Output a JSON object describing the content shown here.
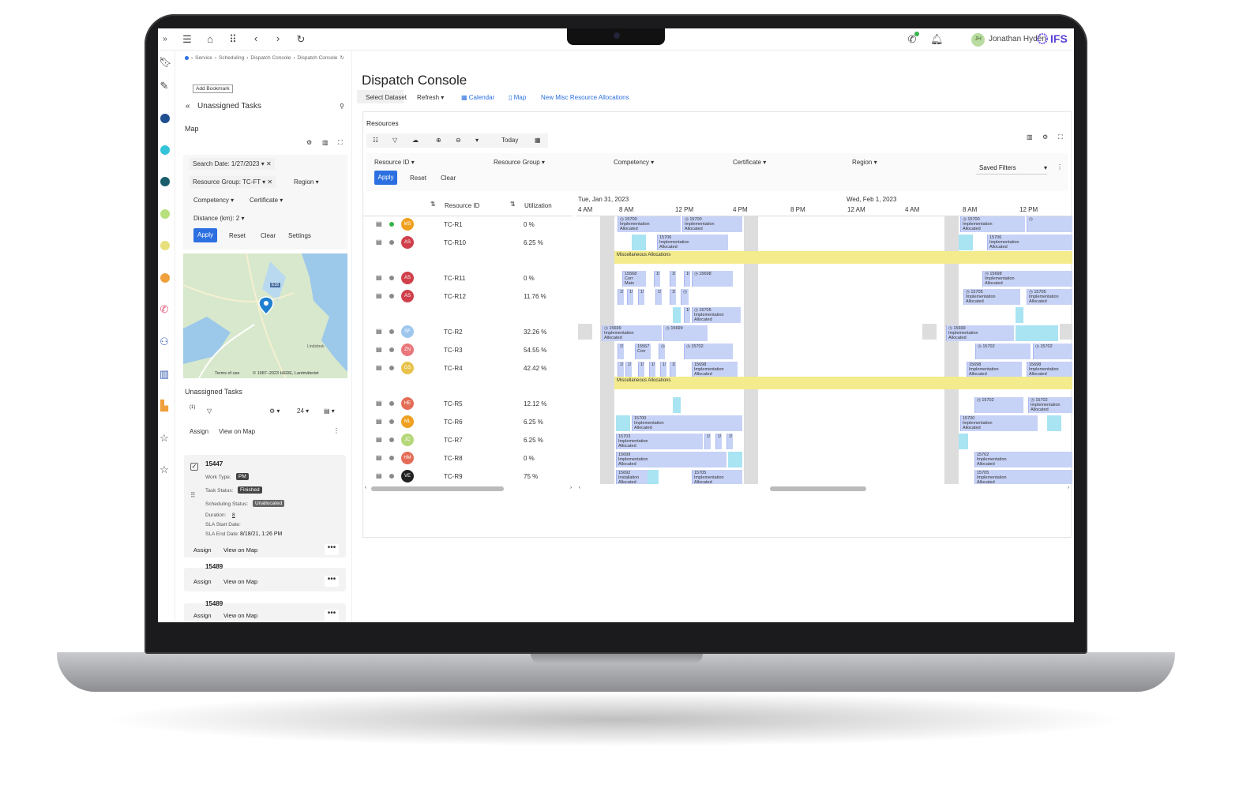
{
  "app": {
    "logo": "IFS",
    "user_initials": "JH",
    "user_name": "Jonathan Hydén"
  },
  "breadcrumb": [
    "Service",
    "Scheduling",
    "Dispatch Console",
    "Dispatch Console"
  ],
  "tooltip": "Add Bookmark",
  "left_panel": {
    "title": "Unassigned Tasks",
    "map_title": "Map",
    "filters": {
      "search_date": "Search Date: 1/27/2023",
      "resource_group": "Resource Group: TC-FT",
      "region": "Region",
      "competency": "Competency",
      "certificate": "Certificate",
      "distance": "Distance (km): 2"
    },
    "buttons": {
      "apply": "Apply",
      "reset": "Reset",
      "clear": "Clear",
      "settings": "Settings"
    },
    "map_footer": {
      "terms": "Terms of use",
      "copyright": "© 1987–2023 HERE, Lantmäteriet",
      "road": "E18",
      "place": "Lindsbruk"
    },
    "tasks_title": "Unassigned Tasks",
    "tasks_count": "(1)",
    "page_size": "24",
    "assign": "Assign",
    "view_on_map": "View on Map",
    "task": {
      "id": "15447",
      "work_type_label": "Work Type:",
      "work_type": "PM",
      "task_status_label": "Task Status:",
      "task_status": "Finished",
      "scheduling_status_label": "Scheduling Status:",
      "scheduling_status": "Unallocated",
      "duration_label": "Duration:",
      "duration": "8",
      "sla_start_label": "SLA Start Date:",
      "sla_end_label": "SLA End Date:",
      "sla_end": "8/18/21, 1:26 PM"
    },
    "more_tasks": [
      "15489",
      "15489",
      "15489"
    ]
  },
  "main": {
    "title": "Dispatch Console",
    "toolbar": {
      "select_dataset": "Select Dataset",
      "refresh": "Refresh",
      "calendar": "Calendar",
      "map": "Map",
      "new_misc": "New Misc Resource Allocations"
    },
    "resources_title": "Resources",
    "today": "Today",
    "filters": [
      "Resource ID",
      "Resource Group",
      "Competency",
      "Certificate",
      "Region"
    ],
    "apply": "Apply",
    "reset": "Reset",
    "clear": "Clear",
    "saved_filters": "Saved Filters",
    "columns": {
      "resource_id": "Resource ID",
      "utilization": "Utilization"
    },
    "dates": {
      "day1": "Tue, Jan 31, 2023",
      "day2": "Wed, Feb 1, 2023"
    },
    "hours": [
      "4 AM",
      "8 AM",
      "12 PM",
      "4 PM",
      "8 PM",
      "12 AM",
      "4 AM",
      "8 AM",
      "12 PM"
    ],
    "misc": "Miscellaneous Allocations",
    "bar_text": {
      "impl": "Implementation",
      "alloc": "Allocated",
      "install": "Installation",
      "corr": "Corr",
      "main": "Main",
      "p": "Pr",
      "m": "M",
      "one": "1!"
    },
    "ids": [
      "15700",
      "15706",
      "15568",
      "15698",
      "15705",
      "15699",
      "15567",
      "15702",
      "15703",
      "15692"
    ],
    "resources": [
      {
        "initials": "MS",
        "color": "#f0a020",
        "status": "#36b24a",
        "id": "TC-R1",
        "util": "0 %"
      },
      {
        "initials": "AS",
        "color": "#d0404a",
        "status": "#8a8a8a",
        "id": "TC-R10",
        "util": "6.25 %"
      },
      {
        "initials": "AS",
        "color": "#d0404a",
        "status": "#8a8a8a",
        "id": "TC-R11",
        "util": "0 %"
      },
      {
        "initials": "AS",
        "color": "#d0404a",
        "status": "#8a8a8a",
        "id": "TC-R12",
        "util": "11.76 %"
      },
      {
        "initials": "SF",
        "color": "#9ec7ee",
        "status": "#8a8a8a",
        "id": "TC-R2",
        "util": "32.26 %"
      },
      {
        "initials": "ZN",
        "color": "#e9767a",
        "status": "#8a8a8a",
        "id": "TC-R3",
        "util": "54.55 %"
      },
      {
        "initials": "GS",
        "color": "#e8c24a",
        "status": "#8a8a8a",
        "id": "TC-R4",
        "util": "42.42 %"
      },
      {
        "initials": "HE",
        "color": "#e46d57",
        "status": "#8a8a8a",
        "id": "TC-R5",
        "util": "12.12 %"
      },
      {
        "initials": "ML",
        "color": "#f0a020",
        "status": "#8a8a8a",
        "id": "TC-R6",
        "util": "6.25 %"
      },
      {
        "initials": "JC",
        "color": "#b5d77a",
        "status": "#8a8a8a",
        "id": "TC-R7",
        "util": "6.25 %"
      },
      {
        "initials": "HM",
        "color": "#e46d57",
        "status": "#8a8a8a",
        "id": "TC-R8",
        "util": "0 %"
      },
      {
        "initials": "VE",
        "color": "#222222",
        "status": "#8a8a8a",
        "id": "TC-R9",
        "util": "75 %"
      }
    ]
  }
}
